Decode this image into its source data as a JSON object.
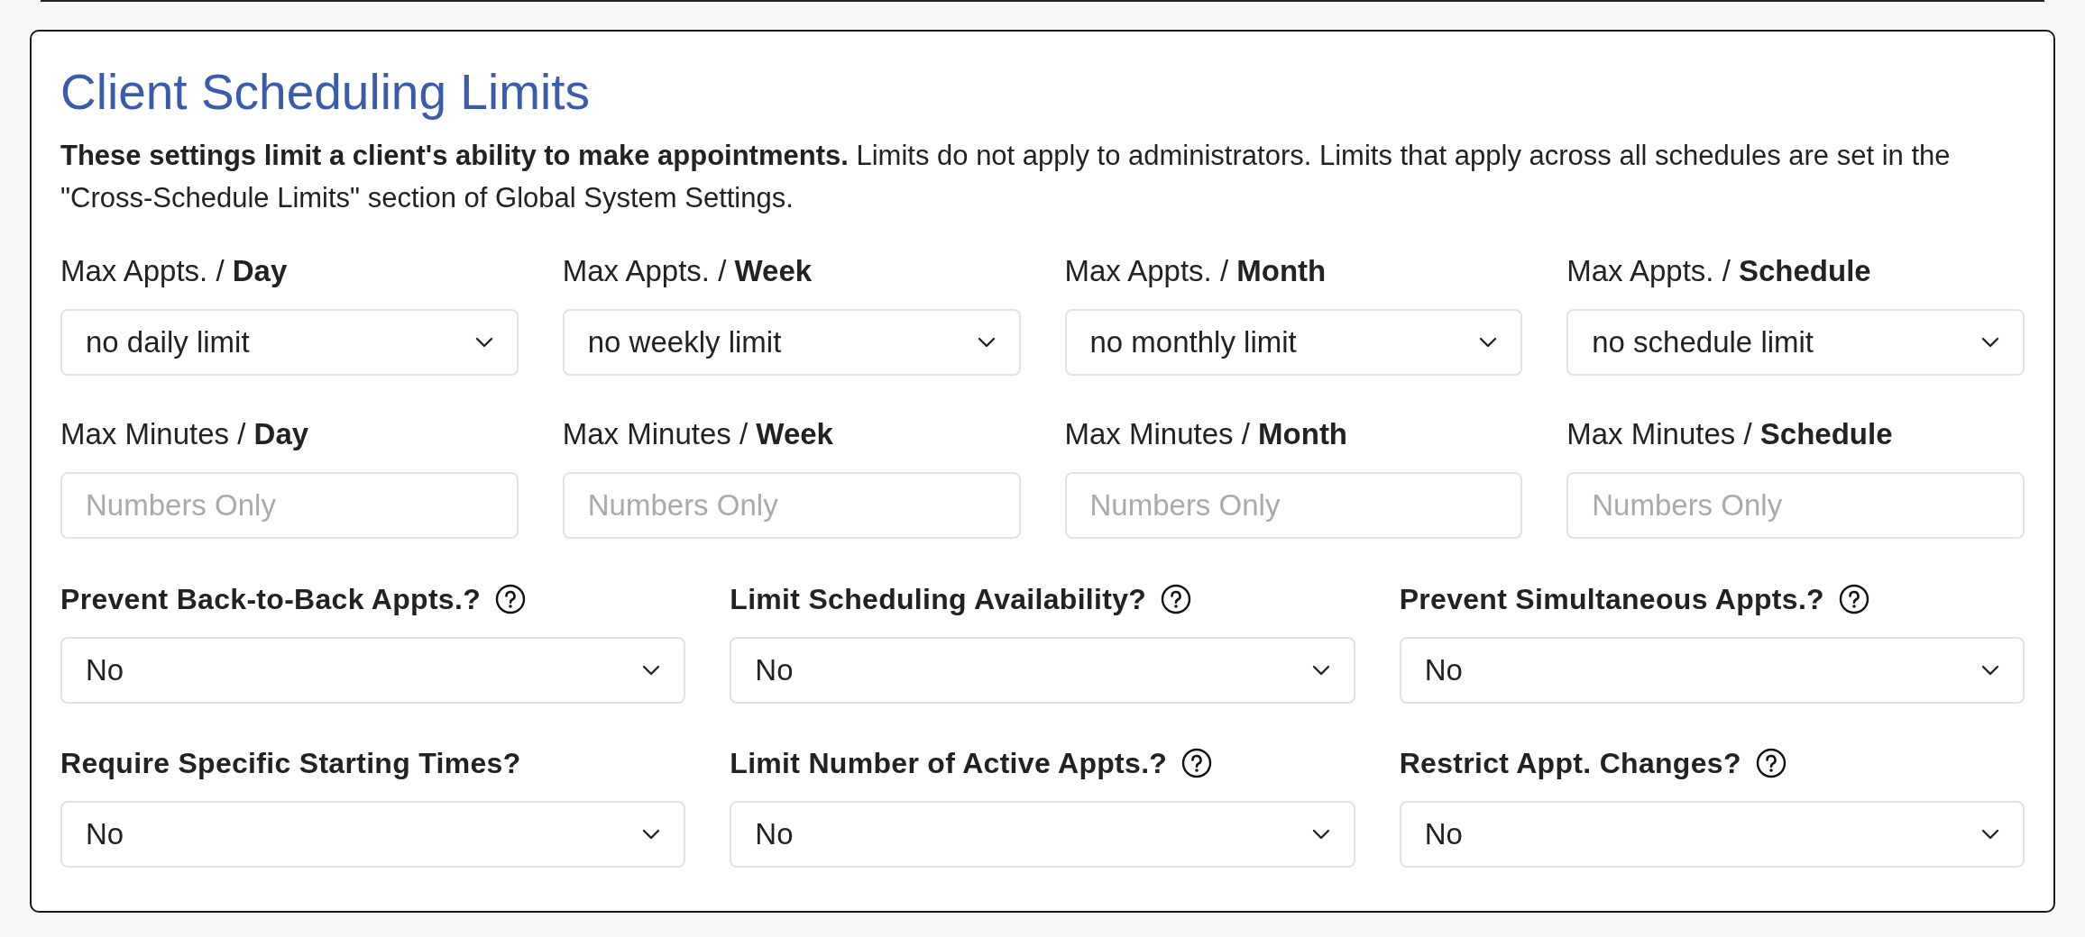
{
  "section": {
    "title": "Client Scheduling Limits",
    "intro": "**These settings limit a client's ability to make appointments.** Limits do not apply to administrators. Limits that apply across all schedules are set in the \"Cross-Schedule Limits\" section of Global System Settings.",
    "limit_fields": [
      {
        "kind": "select",
        "label": "Max Appts. / **Day**",
        "value": "no daily limit"
      },
      {
        "kind": "select",
        "label": "Max Appts. / **Week**",
        "value": "no weekly limit"
      },
      {
        "kind": "select",
        "label": "Max Appts. / **Month**",
        "value": "no monthly limit"
      },
      {
        "kind": "select",
        "label": "Max Appts. / **Schedule**",
        "value": "no schedule limit"
      },
      {
        "kind": "input",
        "label": "Max Minutes / **Day**",
        "placeholder": "Numbers Only"
      },
      {
        "kind": "input",
        "label": "Max Minutes / **Week**",
        "placeholder": "Numbers Only"
      },
      {
        "kind": "input",
        "label": "Max Minutes / **Month**",
        "placeholder": "Numbers Only"
      },
      {
        "kind": "input",
        "label": "Max Minutes / **Schedule**",
        "placeholder": "Numbers Only"
      }
    ],
    "option_fields": [
      {
        "label": "Prevent Back-to-Back Appts.?",
        "help": true,
        "value": "No"
      },
      {
        "label": "Limit Scheduling Availability?",
        "help": true,
        "value": "No"
      },
      {
        "label": "Prevent Simultaneous Appts.?",
        "help": true,
        "value": "No"
      },
      {
        "label": "Require Specific Starting Times?",
        "help": false,
        "value": "No"
      },
      {
        "label": "Limit Number of Active Appts.?",
        "help": true,
        "value": "No"
      },
      {
        "label": "Restrict Appt. Changes?",
        "help": true,
        "value": "No"
      }
    ]
  }
}
